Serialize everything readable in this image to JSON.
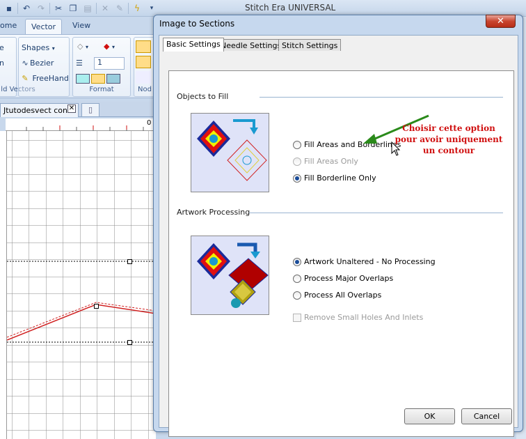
{
  "app": {
    "title": "Stitch Era UNIVERSAL",
    "ribbon_tabs": [
      "ome",
      "Vector",
      "View"
    ],
    "ribbon_items": {
      "col1_1": "e",
      "col1_2": "n",
      "shapes": "Shapes",
      "bezier": "Bezier",
      "freehand": "FreeHand",
      "line_width_value": "1"
    },
    "ribbon_groups": [
      "ld Vectors",
      "Format",
      "Nod"
    ],
    "document_tab": "Jtutodesvect conto",
    "ruler_zero": "0"
  },
  "dialog": {
    "title": "Image to Sections",
    "close_label": "✕",
    "tabs": [
      "Basic Settings",
      "Needle Settings",
      "Stitch Settings"
    ],
    "objects_to_fill": {
      "title": "Objects to Fill",
      "options": [
        {
          "label": "Fill Areas and Borderlines",
          "checked": false,
          "disabled": false
        },
        {
          "label": "Fill Areas Only",
          "checked": false,
          "disabled": true
        },
        {
          "label": "Fill Borderline Only",
          "checked": true,
          "disabled": false
        }
      ]
    },
    "artwork_processing": {
      "title": "Artwork Processing",
      "options": [
        {
          "label": "Artwork Unaltered - No Processing",
          "checked": true,
          "disabled": false
        },
        {
          "label": "Process Major Overlaps",
          "checked": false,
          "disabled": false
        },
        {
          "label": "Process All Overlaps",
          "checked": false,
          "disabled": false
        }
      ],
      "checkbox_label": "Remove Small Holes And Inlets"
    },
    "ok_label": "OK",
    "cancel_label": "Cancel"
  },
  "annotation": {
    "lines": [
      "Choisir cette option",
      "pour avoir uniquement",
      "un contour"
    ],
    "color": "#d01010",
    "arrow_color": "#2a8a1a"
  },
  "colors": {
    "dialog_frame": "#c6d8ee",
    "group_line": "#99b4d1",
    "radio_dot": "#1a4c99"
  }
}
